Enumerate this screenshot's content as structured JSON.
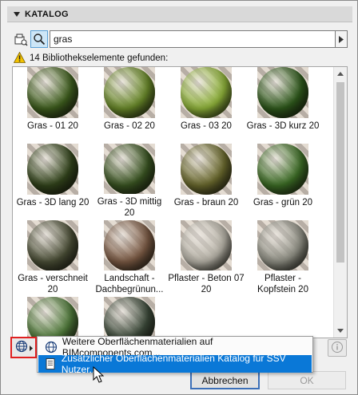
{
  "panel": {
    "title": "KATALOG"
  },
  "search": {
    "value": "gras",
    "status": "14 Bibliothekselemente gefunden:"
  },
  "items": [
    {
      "label": "Gras - 01 20",
      "color": "#3f5f1e"
    },
    {
      "label": "Gras - 02 20",
      "color": "#6a8a2a"
    },
    {
      "label": "Gras - 03 20",
      "color": "#8fb33a"
    },
    {
      "label": "Gras - 3D kurz 20",
      "color": "#2f5a1c"
    },
    {
      "label": "Gras - 3D lang 20",
      "color": "#33451c"
    },
    {
      "label": "Gras - 3D mittig 20",
      "color": "#3a5522"
    },
    {
      "label": "Gras - braun 20",
      "color": "#6b6a2e"
    },
    {
      "label": "Gras - grün 20",
      "color": "#3d6e26"
    },
    {
      "label": "Gras - verschneit 20",
      "color": "#4a4e36"
    },
    {
      "label": "Landschaft - Dachbegrünun...",
      "color": "#7b5a44"
    },
    {
      "label": "Pflaster - Beton 07 20",
      "color": "#b7b3a8"
    },
    {
      "label": "Pflaster - Kopfstein 20",
      "color": "#8f8f84"
    },
    {
      "label": "",
      "color": "#4f7a3a"
    },
    {
      "label": "",
      "color": "#3c4a3a"
    }
  ],
  "popup_menu": {
    "items": [
      {
        "label": "Weitere Oberflächenmaterialien auf BIMcomponents.com...",
        "selected": false
      },
      {
        "label": "Zusätzlicher Oberflächenmaterialien Katalog für SSV Nutzer...",
        "selected": true
      }
    ]
  },
  "buttons": {
    "cancel": "Abbrechen",
    "ok": "OK"
  },
  "colors": {
    "selection": "#0a78d7",
    "highlight_border": "#e02020",
    "warning": "#f2c200"
  }
}
